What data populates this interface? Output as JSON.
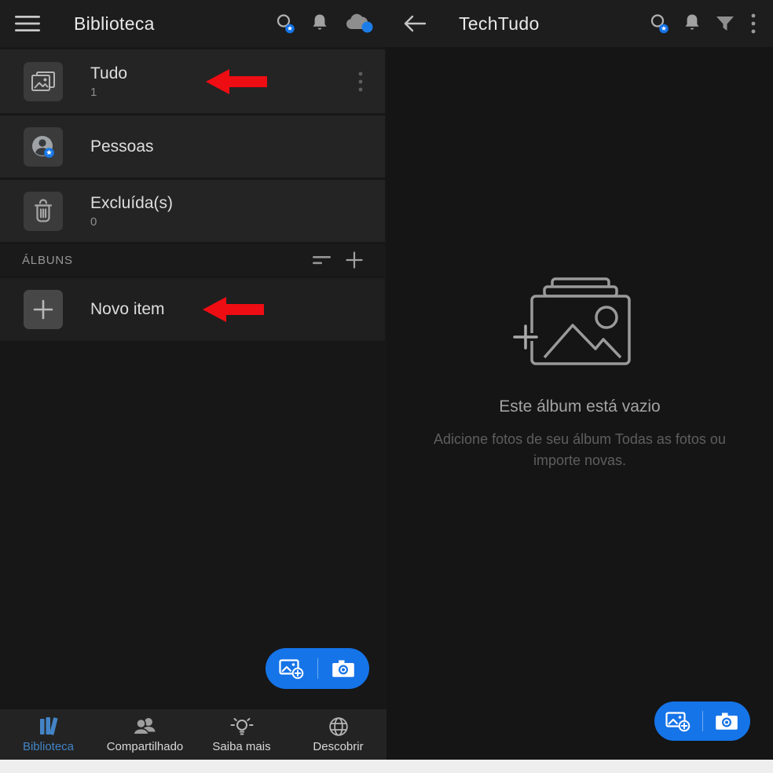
{
  "left_panel": {
    "title": "Biblioteca",
    "rows": [
      {
        "label": "Tudo",
        "count": "1"
      },
      {
        "label": "Pessoas"
      },
      {
        "label": "Excluída(s)",
        "count": "0"
      }
    ],
    "albums_header": "ÁLBUNS",
    "new_item_label": "Novo item",
    "nav": [
      {
        "label": "Biblioteca"
      },
      {
        "label": "Compartilhado"
      },
      {
        "label": "Saiba mais"
      },
      {
        "label": "Descobrir"
      }
    ]
  },
  "right_panel": {
    "title": "TechTudo",
    "empty_state": {
      "title": "Este álbum está vazio",
      "subtitle": "Adicione fotos de seu álbum Todas as fotos ou importe novas."
    }
  },
  "colors": {
    "accent_blue": "#1574e8",
    "badge_blue": "#1473e6",
    "nav_active_blue": "#4384c6",
    "annotation_red": "#ee0d13",
    "row_background": "#242424",
    "header_background": "#1d1d1d"
  },
  "icons": {
    "hamburger": "menu",
    "search_star": "premium search",
    "bell": "notifications",
    "cloud": "cloud sync status",
    "back_arrow": "navigate back",
    "funnel": "filter",
    "kebab": "more options",
    "photos": "all photos",
    "person_star": "people (premium)",
    "trash": "deleted",
    "sort": "sort albums",
    "plus": "add album / new item",
    "add_photo": "add photos",
    "camera": "capture photo",
    "books": "library",
    "people": "shared",
    "lightbulb": "learn",
    "globe": "discover",
    "red_arrow": "annotation arrow"
  }
}
